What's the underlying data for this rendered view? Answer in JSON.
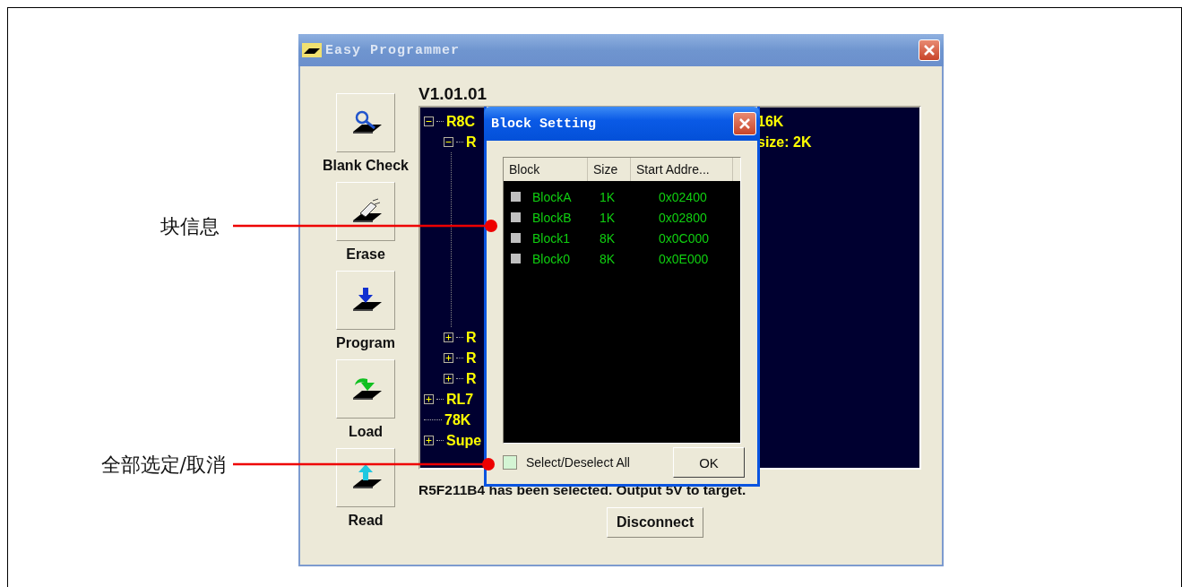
{
  "annotations": [
    {
      "text": "块信息"
    },
    {
      "text": "全部选定/取消"
    }
  ],
  "window": {
    "title": "Easy Programmer"
  },
  "actions": [
    {
      "kind": "blank_check",
      "label": "Blank Check"
    },
    {
      "kind": "erase",
      "label": "Erase"
    },
    {
      "kind": "program",
      "label": "Program"
    },
    {
      "kind": "load",
      "label": "Load"
    },
    {
      "kind": "read",
      "label": "Read"
    }
  ],
  "version": "V1.01.01",
  "tree": [
    {
      "label": "R8C",
      "tail": "16K",
      "expanded": true,
      "children": [
        {
          "label": "R",
          "tail": "size: 2K",
          "expanded": true
        },
        {
          "label": "R",
          "expanded": false
        },
        {
          "label": "R",
          "expanded": false
        },
        {
          "label": "R",
          "expanded": false
        }
      ]
    },
    {
      "label": "RL7",
      "expanded": false
    },
    {
      "label": "78K"
    },
    {
      "label": "Supe",
      "expanded": false
    }
  ],
  "status": "R5F211B4 has been selected. Output 5V to target.",
  "disconnect": "Disconnect",
  "dialog": {
    "title": "Block Setting",
    "columns": [
      "Block",
      "Size",
      "Start Addre..."
    ],
    "rows": [
      {
        "block": "BlockA",
        "size": "1K",
        "start": "0x02400",
        "checked": false
      },
      {
        "block": "BlockB",
        "size": "1K",
        "start": "0x02800",
        "checked": false
      },
      {
        "block": "Block1",
        "size": "8K",
        "start": "0x0C000",
        "checked": false
      },
      {
        "block": "Block0",
        "size": "8K",
        "start": "0x0E000",
        "checked": false
      }
    ],
    "select_all": {
      "label": "Select/Deselect All",
      "checked": false
    },
    "ok": "OK"
  }
}
